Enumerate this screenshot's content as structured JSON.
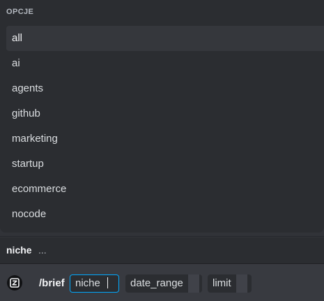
{
  "popup": {
    "header": "OPCJE",
    "options": [
      {
        "label": "all",
        "selected": true
      },
      {
        "label": "ai",
        "selected": false
      },
      {
        "label": "agents",
        "selected": false
      },
      {
        "label": "github",
        "selected": false
      },
      {
        "label": "marketing",
        "selected": false
      },
      {
        "label": "startup",
        "selected": false
      },
      {
        "label": "ecommerce",
        "selected": false
      },
      {
        "label": "nocode",
        "selected": false
      }
    ]
  },
  "hint": {
    "param_name": "niche",
    "param_description": "..."
  },
  "command": {
    "app_icon": "bot-app-icon",
    "name": "/brief",
    "params": [
      {
        "label": "niche",
        "active": true
      },
      {
        "label": "date_range",
        "active": false
      },
      {
        "label": "limit",
        "active": false
      }
    ]
  },
  "colors": {
    "background": "#313338",
    "popup": "#2b2d31",
    "selected_option": "#35373c",
    "focus_border": "#00a8fc",
    "command_bar": "#383a40"
  }
}
